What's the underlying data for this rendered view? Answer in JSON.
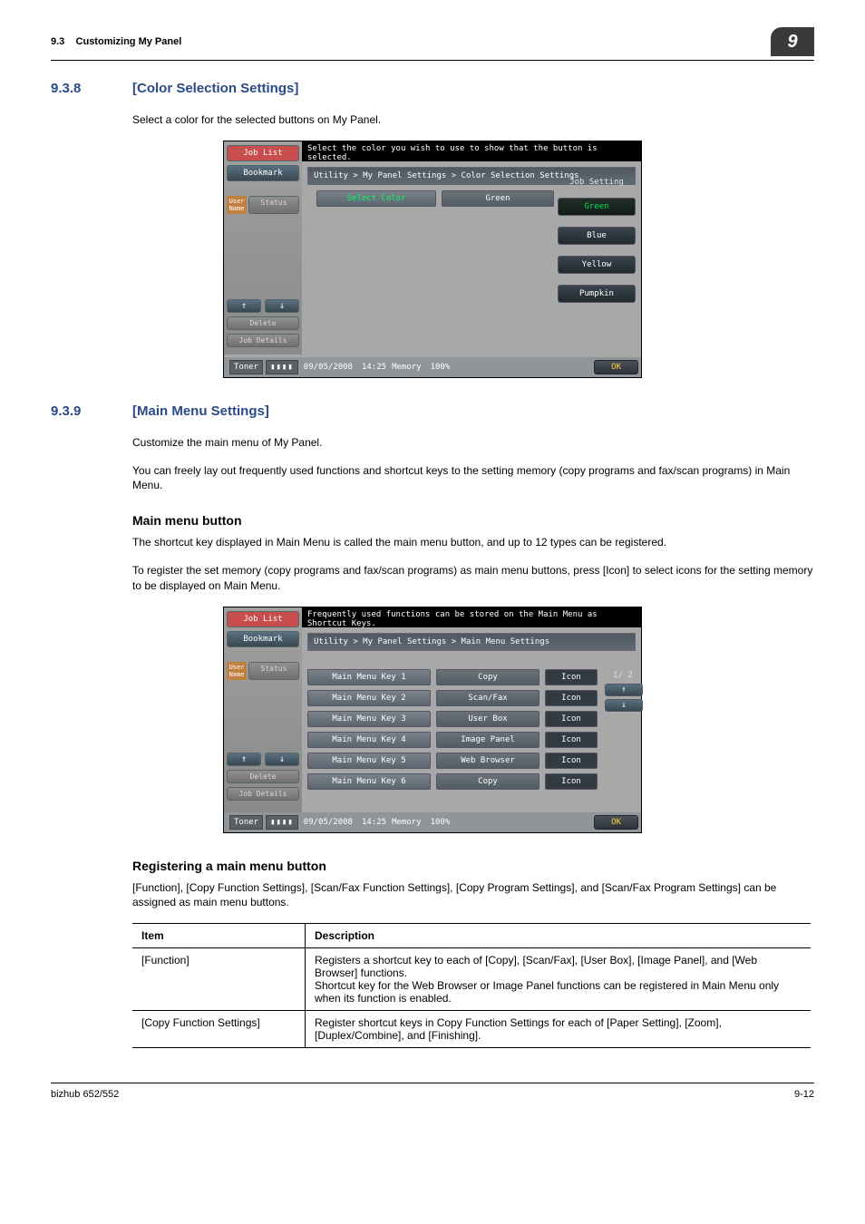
{
  "header": {
    "section": "9.3",
    "title": "Customizing My Panel",
    "chapter": "9"
  },
  "s938": {
    "num": "9.3.8",
    "title": "[Color Selection Settings]",
    "intro": "Select a color for the selected buttons on My Panel."
  },
  "panel1": {
    "job_list": "Job List",
    "bookmark": "Bookmark",
    "user": "User Name",
    "status": "Status",
    "delete": "Delete",
    "job_details": "Job Details",
    "top_msg": "Select the color you wish to use to show that the button is selected.",
    "crumb": "Utility > My Panel Settings > Color Selection Settings",
    "select_color_label": "Select Color",
    "select_color_value": "Green",
    "side_title": "Job Setting",
    "colors": {
      "green": "Green",
      "blue": "Blue",
      "yellow": "Yellow",
      "pumpkin": "Pumpkin"
    },
    "toner": "Toner",
    "date": "09/05/2008",
    "time": "14:25",
    "memory": "Memory",
    "mem_pct": "100%",
    "ok": "OK"
  },
  "s939": {
    "num": "9.3.9",
    "title": "[Main Menu Settings]",
    "intro": "Customize the main menu of My Panel.",
    "para2": "You can freely lay out frequently used functions and shortcut keys to the setting memory (copy programs and fax/scan programs) in Main Menu."
  },
  "mm_heading": "Main menu button",
  "mm_p1": "The shortcut key displayed in Main Menu is called the main menu button, and up to 12 types can be registered.",
  "mm_p2": "To register the set memory (copy programs and fax/scan programs) as main menu buttons, press [Icon] to select icons for the setting memory to be displayed on Main Menu.",
  "panel2": {
    "top_msg": "Frequently used functions can be stored on the Main Menu as Shortcut Keys.",
    "crumb": "Utility > My Panel Settings > Main Menu Settings",
    "rows": [
      {
        "key": "Main Menu Key 1",
        "val": "Copy",
        "icon": "Icon"
      },
      {
        "key": "Main Menu Key 2",
        "val": "Scan/Fax",
        "icon": "Icon"
      },
      {
        "key": "Main Menu Key 3",
        "val": "User Box",
        "icon": "Icon"
      },
      {
        "key": "Main Menu Key 4",
        "val": "Image Panel",
        "icon": "Icon"
      },
      {
        "key": "Main Menu Key 5",
        "val": "Web Browser",
        "icon": "Icon"
      },
      {
        "key": "Main Menu Key 6",
        "val": "Copy",
        "icon": "Icon"
      }
    ],
    "pager": "1/ 2"
  },
  "reg_heading": "Registering a main menu button",
  "reg_intro": "[Function], [Copy Function Settings], [Scan/Fax Function Settings], [Copy Program Settings], and [Scan/Fax Program Settings] can be assigned as main menu buttons.",
  "table": {
    "h1": "Item",
    "h2": "Description",
    "r1c1": "[Function]",
    "r1c2": "Registers a shortcut key to each of [Copy], [Scan/Fax], [User Box], [Image Panel], and [Web Browser] functions.\nShortcut key for the Web Browser or Image Panel functions can be registered in Main Menu only when its function is enabled.",
    "r2c1": "[Copy Function Settings]",
    "r2c2": "Register shortcut keys in Copy Function Settings for each of [Paper Setting], [Zoom], [Duplex/Combine], and [Finishing]."
  },
  "footer": {
    "left": "bizhub 652/552",
    "right": "9-12"
  }
}
